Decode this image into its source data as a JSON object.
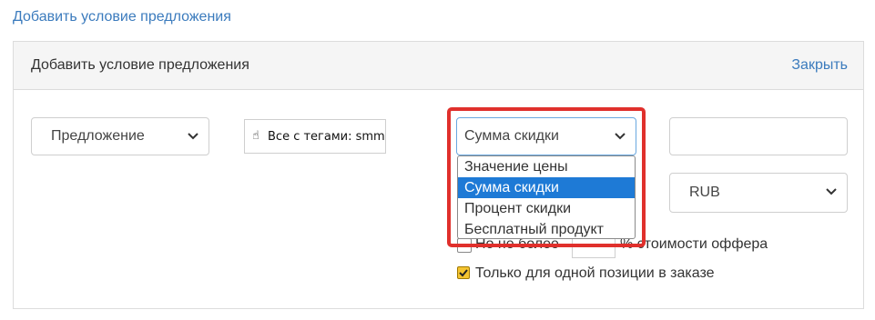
{
  "top_link": "Добавить условие предложения",
  "panel": {
    "title": "Добавить условие предложения",
    "close_label": "Закрыть"
  },
  "offer_select": {
    "value": "Предложение"
  },
  "tag_filter": {
    "label": "Все с тегами: smm"
  },
  "discount_type_select": {
    "value": "Сумма скидки",
    "options": [
      "Значение цены",
      "Сумма скидки",
      "Процент скидки",
      "Бесплатный продукт"
    ],
    "selected_index": 1
  },
  "value_input": {
    "value": ""
  },
  "currency_select": {
    "value": "RUB"
  },
  "limit_row": {
    "label_before": "Но не более",
    "label_after": "% стоимости оффера",
    "checked": false
  },
  "single_item": {
    "label": "Только для одной позиции в заказе",
    "checked": true
  },
  "colors": {
    "link": "#3b7bbd",
    "highlight": "#e0302c",
    "option_selected": "#1e7ad6"
  }
}
